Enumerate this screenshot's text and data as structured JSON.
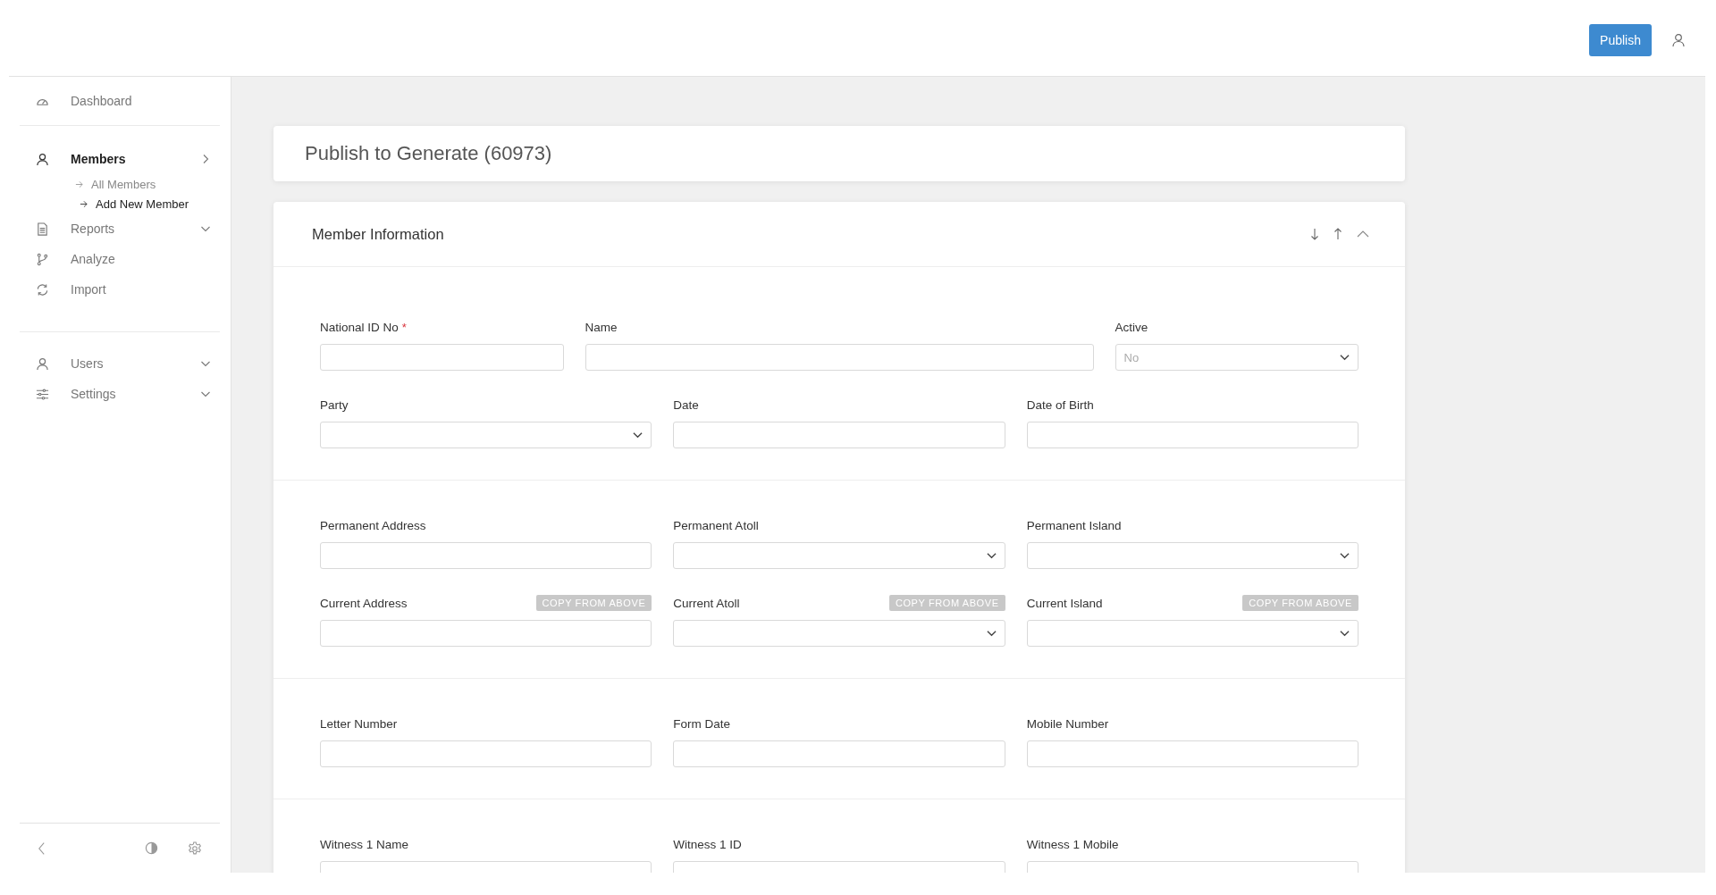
{
  "header": {
    "publish_button": "Publish"
  },
  "sidebar": {
    "groups": [
      {
        "items": [
          {
            "label": "Dashboard",
            "selected": false
          }
        ]
      },
      {
        "items": [
          {
            "label": "Members",
            "selected": true,
            "expanded": true,
            "children": [
              {
                "label": "All Members",
                "selected": false
              },
              {
                "label": "Add New Member",
                "selected": true
              }
            ]
          },
          {
            "label": "Reports",
            "selected": false,
            "expanded": false
          },
          {
            "label": "Analyze",
            "selected": false
          },
          {
            "label": "Import",
            "selected": false
          }
        ]
      },
      {
        "items": [
          {
            "label": "Users",
            "selected": false,
            "expanded": false
          },
          {
            "label": "Settings",
            "selected": false,
            "expanded": false
          }
        ]
      }
    ]
  },
  "page_title": "Publish to Generate (60973)",
  "form": {
    "title": "Member Information",
    "sections": [
      {
        "rows": [
          {
            "fields": [
              {
                "label": "National ID No",
                "required_mark": "*",
                "kind": "text"
              },
              {
                "label": "Name",
                "kind": "text",
                "wide": true
              },
              {
                "label": "Active",
                "kind": "select",
                "value": "No"
              }
            ]
          },
          {
            "fields": [
              {
                "label": "Party",
                "kind": "select"
              },
              {
                "label": "Date",
                "kind": "text"
              },
              {
                "label": "Date of Birth",
                "kind": "text"
              }
            ]
          }
        ]
      },
      {
        "rows": [
          {
            "fields": [
              {
                "label": "Permanent Address",
                "kind": "text"
              },
              {
                "label": "Permanent Atoll",
                "kind": "select"
              },
              {
                "label": "Permanent Island",
                "kind": "select"
              }
            ]
          },
          {
            "fields": [
              {
                "label": "Current Address",
                "kind": "text",
                "copy_button": "COPY FROM ABOVE"
              },
              {
                "label": "Current Atoll",
                "kind": "select",
                "copy_button": "COPY FROM ABOVE"
              },
              {
                "label": "Current Island",
                "kind": "select",
                "copy_button": "COPY FROM ABOVE"
              }
            ]
          }
        ]
      },
      {
        "rows": [
          {
            "fields": [
              {
                "label": "Letter Number",
                "kind": "text"
              },
              {
                "label": "Form Date",
                "kind": "text"
              },
              {
                "label": "Mobile Number",
                "kind": "text"
              }
            ]
          }
        ]
      },
      {
        "rows": [
          {
            "fields": [
              {
                "label": "Witness 1 Name",
                "kind": "text"
              },
              {
                "label": "Witness 1 ID",
                "kind": "text"
              },
              {
                "label": "Witness 1 Mobile",
                "kind": "text"
              }
            ]
          }
        ]
      }
    ]
  }
}
